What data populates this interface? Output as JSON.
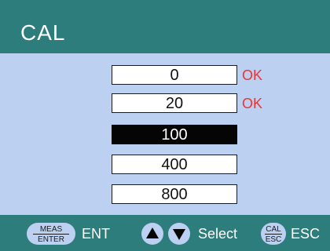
{
  "header": {
    "title": "CAL"
  },
  "calibration_points": [
    {
      "value": "0",
      "status": "OK",
      "selected": false
    },
    {
      "value": "20",
      "status": "OK",
      "selected": false
    },
    {
      "value": "100",
      "status": "",
      "selected": true
    },
    {
      "value": "400",
      "status": "",
      "selected": false
    },
    {
      "value": "800",
      "status": "",
      "selected": false
    }
  ],
  "footer": {
    "meas_enter_key": {
      "top": "MEAS",
      "bottom": "ENTER",
      "label": "ENT"
    },
    "select_label": "Select",
    "cal_esc_key": {
      "top": "CAL",
      "bottom": "ESC",
      "label": "ESC"
    }
  },
  "colors": {
    "header_bg": "#2d7d7d",
    "panel_bg": "#bcd0f1",
    "ok": "#ee3333",
    "selected_bg": "#050505"
  },
  "icons": {
    "up": "up-triangle-icon",
    "down": "down-triangle-icon"
  }
}
